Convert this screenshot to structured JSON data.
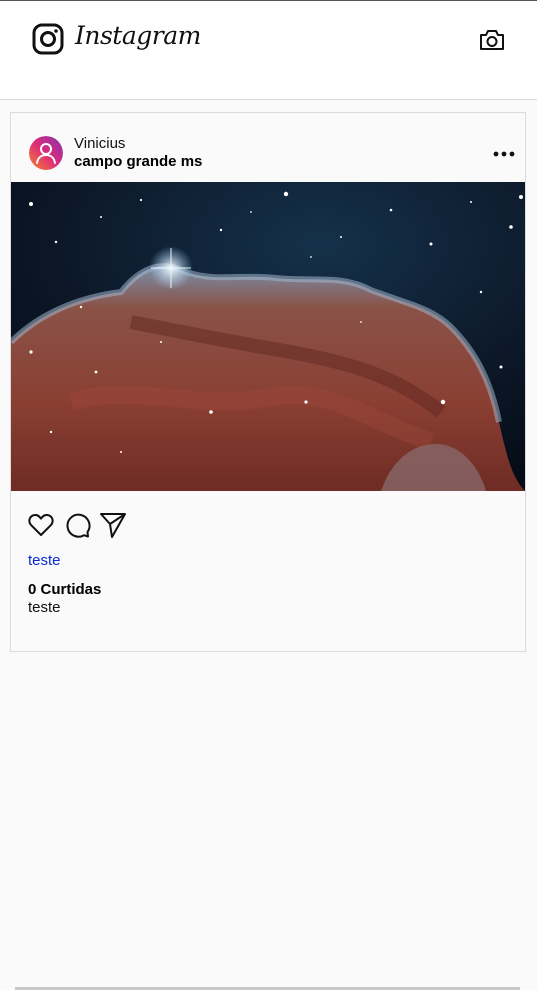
{
  "app": {
    "wordmark": "Instagram"
  },
  "header": {
    "icons": [
      "instagram-logo-icon",
      "camera-icon"
    ]
  },
  "post": {
    "author": "Vinicius",
    "location": "campo grande ms",
    "image_description_icon": "nebula-photo",
    "actions": [
      "heart-icon",
      "comment-icon",
      "send-icon"
    ],
    "link_text": "teste",
    "likes": "0 Curtidas",
    "description": "teste"
  },
  "colors": {
    "link": "#0b2bd6",
    "border": "#dbdbdb",
    "background": "#fafafa",
    "avatar_gradient": [
      "#f58529",
      "#dd2a7b",
      "#8134af"
    ]
  }
}
